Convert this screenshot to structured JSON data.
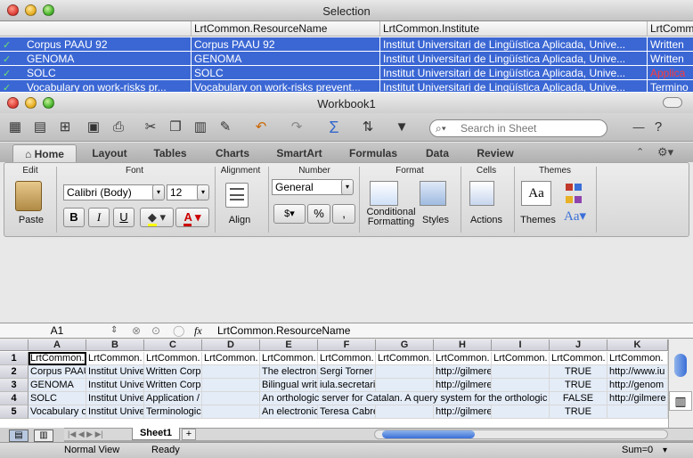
{
  "selection": {
    "title": "Selection",
    "headers": [
      "",
      "LrtCommon.ResourceName",
      "LrtCommon.Institute",
      "LrtCommon"
    ],
    "rows": [
      [
        "Corpus PAAU 92",
        "Corpus PAAU 92",
        "Institut Universitari de Lingüística Aplicada, Unive...",
        "Written"
      ],
      [
        "GENOMA",
        "GENOMA",
        "Institut Universitari de Lingüística Aplicada, Unive...",
        "Written"
      ],
      [
        "SOLC",
        "SOLC",
        "Institut Universitari de Lingüística Aplicada, Unive...",
        "Applica"
      ],
      [
        "Vocabulary on work-risks pr...",
        "Vocabulary on work-risks prevent...",
        "Institut Universitari de Lingüística Aplicada, Unive...",
        "Termino"
      ]
    ]
  },
  "workbook": {
    "title": "Workbook1",
    "search_placeholder": "Search in Sheet",
    "tabs": [
      "Home",
      "Layout",
      "Tables",
      "Charts",
      "SmartArt",
      "Formulas",
      "Data",
      "Review"
    ],
    "groups": [
      "Edit",
      "Font",
      "Alignment",
      "Number",
      "Format",
      "Cells",
      "Themes"
    ],
    "font_name": "Calibri (Body)",
    "font_size": "12",
    "number_format": "General",
    "labels": {
      "paste": "Paste",
      "align": "Align",
      "cond1": "Conditional",
      "cond2": "Formatting",
      "styles": "Styles",
      "actions": "Actions",
      "themes": "Themes",
      "bold": "B",
      "italic": "I",
      "underline": "U",
      "aa": "Aa"
    },
    "cell_ref": "A1",
    "fx": "fx",
    "formula": "LrtCommon.ResourceName",
    "columns": [
      "A",
      "B",
      "C",
      "D",
      "E",
      "F",
      "G",
      "H",
      "I",
      "J",
      "K"
    ],
    "rows": [
      [
        "1",
        "LrtCommon.",
        "LrtCommon.",
        "LrtCommon.",
        "LrtCommon.",
        "LrtCommon.",
        "LrtCommon.",
        "LrtCommon.",
        "LrtCommon.",
        "LrtCommon.",
        "LrtCommon.",
        "LrtCommon."
      ],
      [
        "2",
        "Corpus PAAU",
        "Institut Unive",
        "Written Corpus",
        "",
        "The electron",
        "Sergi Torner <sergi.torner",
        "",
        "http://gilmere.upf.edu/oa",
        "",
        "TRUE",
        "http://www.iu"
      ],
      [
        "3",
        "GENOMA",
        "Institut Unive",
        "Written Corpus",
        "",
        "Bilingual writ",
        "iula.secretaria@upf.edu",
        "",
        "http://gilmere.upf.edu/oa",
        "",
        "TRUE",
        "http://genom"
      ],
      [
        "4",
        "SOLC",
        "Institut Unive",
        "Application / Tool",
        "",
        "An orthologic server for Catalan. A query system for the orthologic",
        "",
        "",
        "",
        "",
        "FALSE",
        "http://gilmere"
      ],
      [
        "5",
        "Vocabulary o",
        "Institut Unive",
        "Terminological Resource",
        "",
        "An electronic",
        "Teresa Cabré <teresa.cabr",
        "",
        "http://gilmere.upf.edu/oa",
        "",
        "TRUE",
        ""
      ]
    ],
    "sheet_tab": "Sheet1",
    "status_view": "Normal View",
    "status_ready": "Ready",
    "status_sum": "Sum=0"
  }
}
